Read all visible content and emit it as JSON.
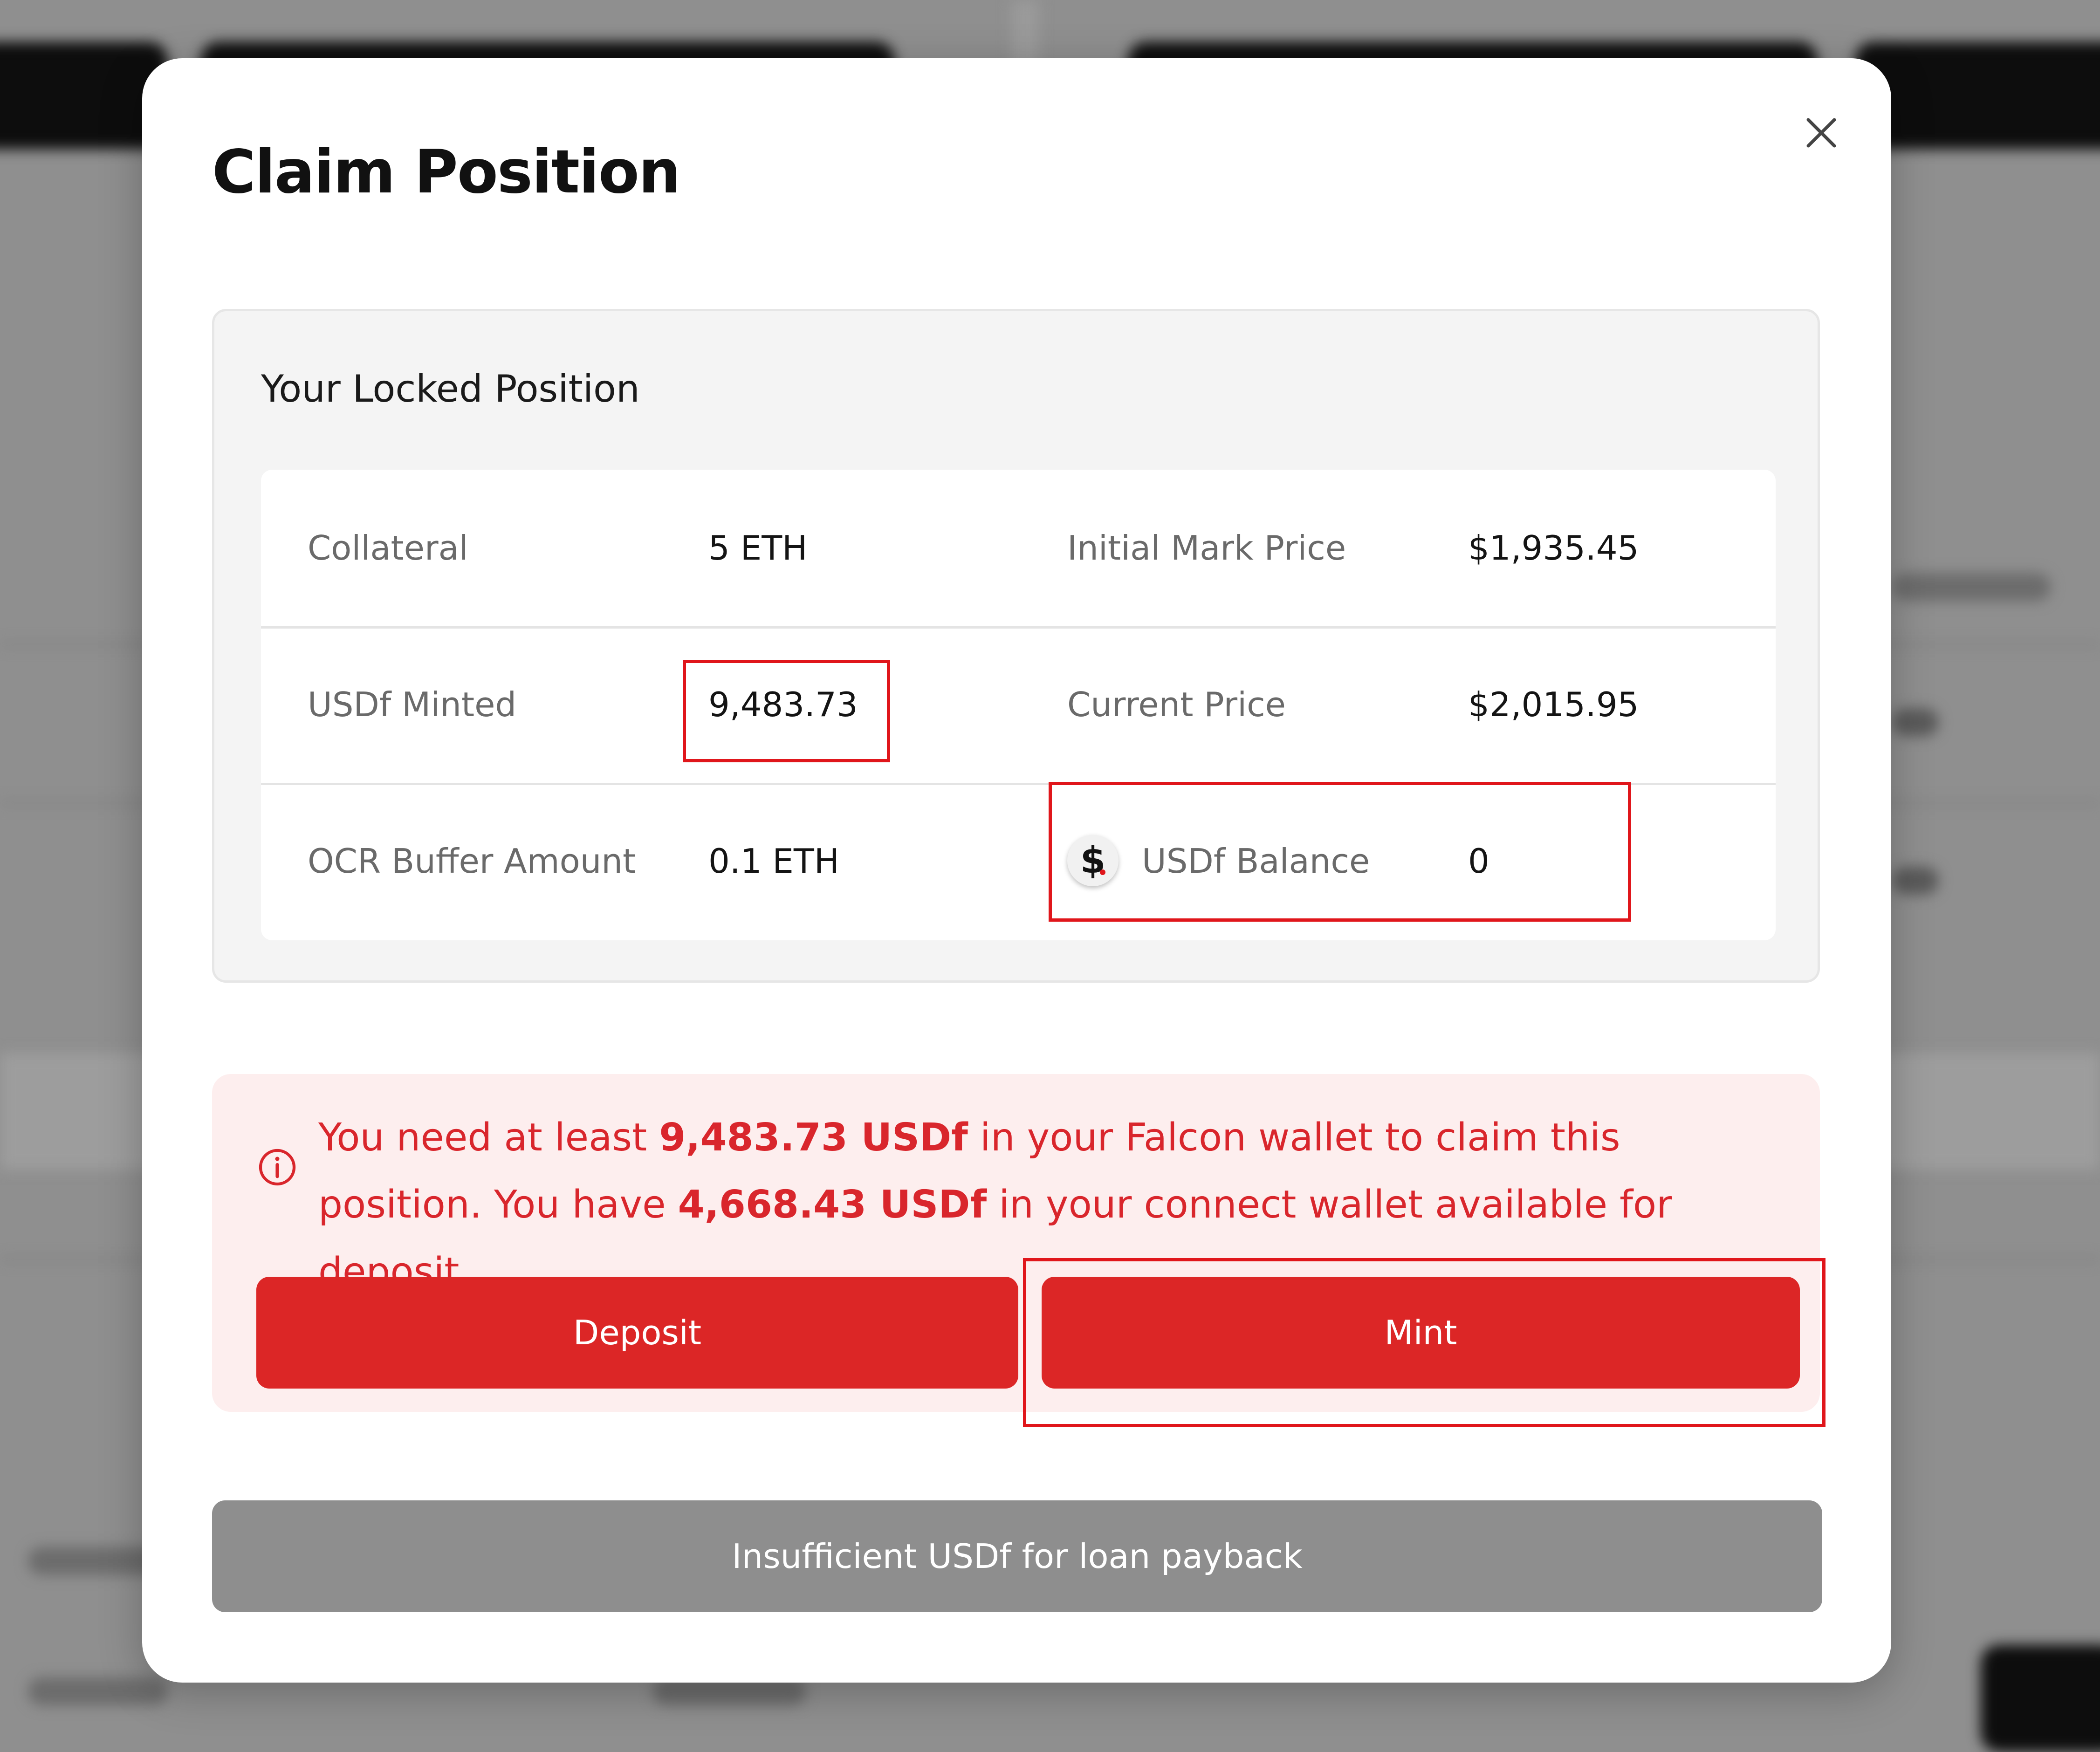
{
  "modal": {
    "title": "Claim Position",
    "close_icon": "close-icon"
  },
  "locked_position": {
    "title": "Your Locked Position",
    "rows": [
      {
        "label_left": "Collateral",
        "value_left": "5 ETH",
        "label_right": "Initial Mark Price",
        "value_right": "$1,935.45"
      },
      {
        "label_left": "USDf Minted",
        "value_left": "9,483.73",
        "label_right": "Current Price",
        "value_right": "$2,015.95"
      },
      {
        "label_left": "OCR Buffer Amount",
        "value_left": "0.1 ETH",
        "label_right": "USDf Balance",
        "value_right": "0"
      }
    ],
    "balance_icon": "dollar-coin-icon",
    "balance_icon_glyph": "$"
  },
  "warning": {
    "icon": "info-icon",
    "text_1": "You need at least ",
    "required_amount": "9,483.73 USDf",
    "text_2": " in your Falcon wallet to claim this position. You have ",
    "available_amount": "4,668.43 USDf",
    "text_3": " in your connect wallet available for deposit.",
    "deposit_label": "Deposit",
    "mint_label": "Mint"
  },
  "footer": {
    "payback_label": "Insufficient USDf for loan payback"
  },
  "colors": {
    "accent": "#dc2626",
    "highlight_box": "#e0161b",
    "warning_bg": "#fdeeee",
    "disabled": "#8e8e8e"
  }
}
